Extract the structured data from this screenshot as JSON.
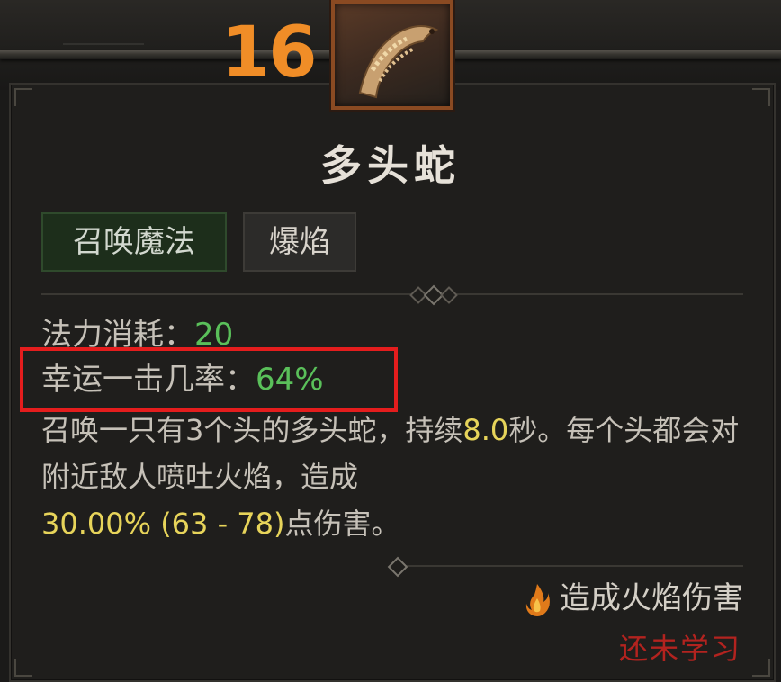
{
  "skill": {
    "level": "16",
    "name": "多头蛇",
    "tags": [
      "召唤魔法",
      "爆焰"
    ],
    "icon": "hydra-skill-icon"
  },
  "stats": {
    "mana_label": "法力消耗：",
    "mana_value": "20",
    "lucky_hit_label": "幸运一击几率：",
    "lucky_hit_value": "64%"
  },
  "description": {
    "p1": "召唤一只有3个头的多头蛇，持续",
    "duration": "8.0",
    "p2": "秒。每个头都会对附近敌人喷吐火焰，造成",
    "damage": "30.00% (63 - 78)",
    "p3": "点伤害。"
  },
  "footer": {
    "damage_type": "造成火焰伤害",
    "status": "还未学习"
  },
  "colors": {
    "level": "#f08d27",
    "stat_value": "#5ac05a",
    "highlight_number": "#e7d45a",
    "annotation_box": "#e41d1d",
    "not_learned": "#b3231f"
  }
}
